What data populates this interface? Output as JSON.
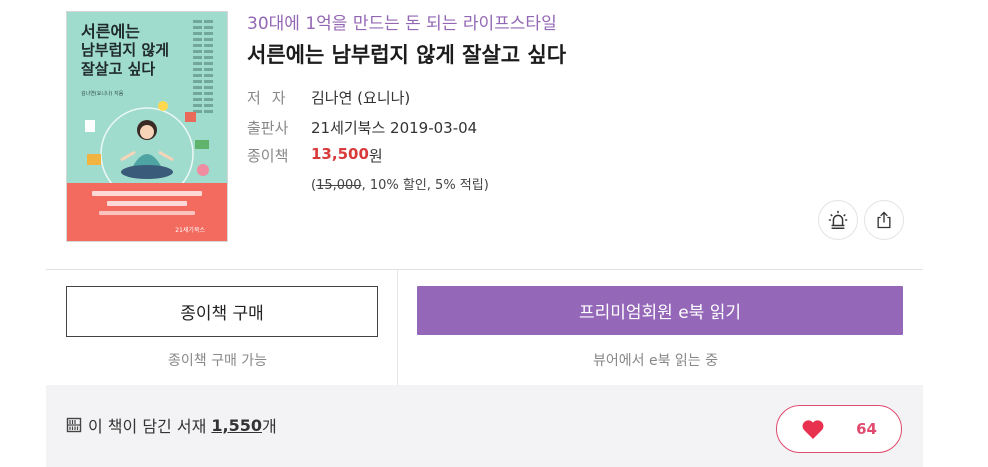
{
  "cover": {
    "title_lines": [
      "서른에는",
      "남부럽지 않게",
      "잘살고 싶다"
    ],
    "author_small": "김나연(요니나) 지음",
    "band_lines": [
      "월급 200만원 받았던 사회초년생이",
      "부자가 될 수 있었을까?",
      "2030 싸테크 멘토 요니나의 실전 가성비 돈 관리법"
    ],
    "publisher_small": "21세기북스"
  },
  "book": {
    "series": "30대에 1억을 만드는 돈 되는 라이프스타일",
    "title": "서른에는 남부럽지 않게 잘살고 싶다"
  },
  "meta": {
    "author_label": "저자",
    "author_value": "김나연 (요니나)",
    "publisher_label": "출판사",
    "publisher_value": "21세기북스 2019-03-04",
    "paper_label": "종이책",
    "price": "13,500",
    "price_unit": "원",
    "discount_open": "(",
    "original_price": "15,000",
    "discount_rest": ", 10% 할인, 5% 적립)"
  },
  "actions": {
    "paper_buy_label": "종이책 구매",
    "paper_buy_note": "종이책 구매 가능",
    "ebook_read_label": "프리미엄회원 e북 읽기",
    "ebook_read_note": "뷰어에서 e북 읽는 중"
  },
  "shelf": {
    "prefix": "이 책이 담긴 서재",
    "count": "1,550",
    "suffix": "개"
  },
  "like": {
    "count": "64"
  },
  "icons": {
    "alert": "alarm-light-icon",
    "share": "share-icon",
    "shelf": "bookshelf-icon",
    "heart": "heart-icon"
  },
  "colors": {
    "accent_purple": "#9467b8",
    "price_red": "#d93a3a",
    "like_pink": "#e04b6f"
  }
}
